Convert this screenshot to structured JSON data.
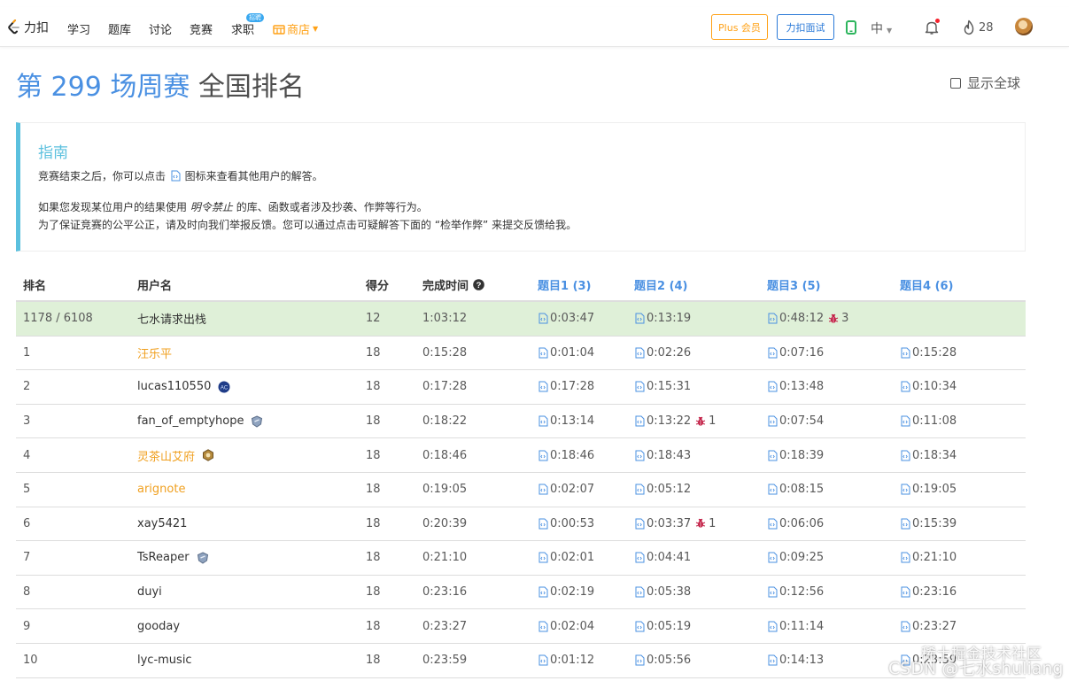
{
  "navbar": {
    "brand": "力扣",
    "items": [
      "学习",
      "题库",
      "讨论",
      "竞赛",
      "求职"
    ],
    "job_badge": "招聘",
    "shop": "商店",
    "plus_button": "Plus 会员",
    "mock_button": "力扣面试",
    "language": "中",
    "streak": "28"
  },
  "title": {
    "contest": "第 299 场周赛",
    "rank": "全国排名"
  },
  "global_toggle": {
    "label": "显示全球",
    "checked": false
  },
  "guide": {
    "title": "指南",
    "line1_pre": "竞赛结束之后，你可以点击",
    "line1_post": "图标来查看其他用户的解答。",
    "line2_pre": "如果您发现某位用户的结果使用",
    "line2_em": "明令禁止",
    "line2_post": "的库、函数或者涉及抄袭、作弊等行为。",
    "line3": "为了保证竞赛的公平公正，请及时向我们举报反馈。您可以通过点击可疑解答下面的 “检举作弊” 来提交反馈给我。"
  },
  "table": {
    "headers": {
      "rank": "排名",
      "user": "用户名",
      "score": "得分",
      "time": "完成时间",
      "q1": "题目1 (3)",
      "q2": "题目2 (4)",
      "q3": "题目3 (5)",
      "q4": "题目4 (6)"
    },
    "self_row": {
      "rank": "1178 / 6108",
      "user": "七水请求出栈",
      "score": "12",
      "time": "1:03:12",
      "q1": "0:03:47",
      "q2": "0:13:19",
      "q3": "0:48:12",
      "q3_penalty": "3",
      "q4": ""
    },
    "rows": [
      {
        "rank": "1",
        "user": "汪乐平",
        "score": "18",
        "time": "0:15:28",
        "q1": "0:01:04",
        "q2": "0:02:26",
        "q2_penalty": "",
        "q3": "0:07:16",
        "q4": "0:15:28"
      },
      {
        "rank": "2",
        "user": "lucas110550",
        "score": "18",
        "time": "0:17:28",
        "q1": "0:17:28",
        "q2": "0:15:31",
        "q2_penalty": "",
        "q3": "0:13:48",
        "q4": "0:10:34"
      },
      {
        "rank": "3",
        "user": "fan_of_emptyhope",
        "score": "18",
        "time": "0:18:22",
        "q1": "0:13:14",
        "q2": "0:13:22",
        "q2_penalty": "1",
        "q3": "0:07:54",
        "q4": "0:11:08"
      },
      {
        "rank": "4",
        "user": "灵茶山艾府",
        "score": "18",
        "time": "0:18:46",
        "q1": "0:18:46",
        "q2": "0:18:43",
        "q2_penalty": "",
        "q3": "0:18:39",
        "q4": "0:18:34"
      },
      {
        "rank": "5",
        "user": "arignote",
        "score": "18",
        "time": "0:19:05",
        "q1": "0:02:07",
        "q2": "0:05:12",
        "q2_penalty": "",
        "q3": "0:08:15",
        "q4": "0:19:05"
      },
      {
        "rank": "6",
        "user": "xay5421",
        "score": "18",
        "time": "0:20:39",
        "q1": "0:00:53",
        "q2": "0:03:37",
        "q2_penalty": "1",
        "q3": "0:06:06",
        "q4": "0:15:39"
      },
      {
        "rank": "7",
        "user": "TsReaper",
        "score": "18",
        "time": "0:21:10",
        "q1": "0:02:01",
        "q2": "0:04:41",
        "q2_penalty": "",
        "q3": "0:09:25",
        "q4": "0:21:10"
      },
      {
        "rank": "8",
        "user": "duyi",
        "score": "18",
        "time": "0:23:16",
        "q1": "0:02:19",
        "q2": "0:05:38",
        "q2_penalty": "",
        "q3": "0:12:56",
        "q4": "0:23:16"
      },
      {
        "rank": "9",
        "user": "gooday",
        "score": "18",
        "time": "0:23:27",
        "q1": "0:02:04",
        "q2": "0:05:19",
        "q2_penalty": "",
        "q3": "0:11:14",
        "q4": "0:23:27"
      },
      {
        "rank": "10",
        "user": "lyc-music",
        "score": "18",
        "time": "0:23:59",
        "q1": "0:01:12",
        "q2": "0:05:56",
        "q2_penalty": "",
        "q3": "0:14:13",
        "q4": "0:23:59"
      }
    ]
  },
  "colors": {
    "accent_blue": "#4a90e2",
    "brand_orange": "#ffa116",
    "guide_blue": "#5bc0de",
    "self_row_green": "#dff0d8"
  },
  "icons": [
    "leetcode-logo-icon",
    "shop-icon",
    "phone-icon",
    "bell-icon",
    "fire-icon",
    "code-doc-icon",
    "bug-icon",
    "help-circle-icon",
    "medal-icon"
  ],
  "watermark": {
    "top": "稀土掘金技术社区",
    "bottom": "CSDN @七水shuliang"
  }
}
